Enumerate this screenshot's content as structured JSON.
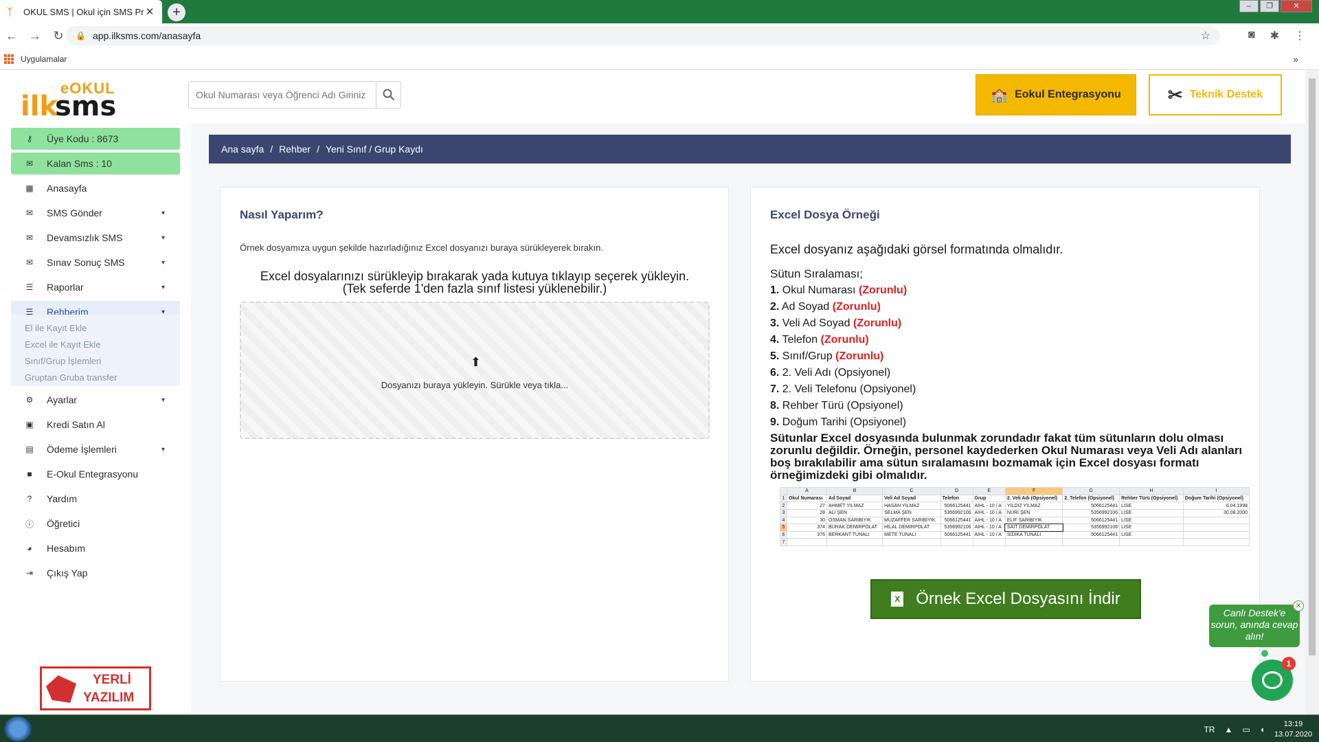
{
  "browser": {
    "tab_title": "OKUL SMS | Okul için SMS Prog",
    "url": "app.ilksms.com/anasayfa",
    "bookmarks_label": "Uygulamalar"
  },
  "header": {
    "logo_top": "eOKUL",
    "logo_ilk": "ilk",
    "logo_sms": "sms",
    "search_placeholder": "Okul Numarası veya Öğrenci Adı Giriniz",
    "eokul_button": "Eokul Entegrasyonu",
    "destek_button": "Teknik Destek"
  },
  "sidebar": {
    "uye_kodu": "Üye Kodu : 8673",
    "kalan_sms": "Kalan Sms : 10",
    "items": [
      {
        "label": "Anasayfa"
      },
      {
        "label": "SMS Gönder"
      },
      {
        "label": "Devamsızlık SMS"
      },
      {
        "label": "Sınav Sonuç SMS"
      },
      {
        "label": "Raporlar"
      },
      {
        "label": "Rehberim"
      },
      {
        "label": "Ayarlar"
      },
      {
        "label": "Kredi Satın Al"
      },
      {
        "label": "Ödeme İşlemleri"
      },
      {
        "label": "E-Okul Entegrasyonu"
      },
      {
        "label": "Yardım"
      },
      {
        "label": "Öğretici"
      },
      {
        "label": "Hesabım"
      },
      {
        "label": "Çıkış Yap"
      }
    ],
    "subitems": [
      {
        "label": "El ile Kayıt Ekle"
      },
      {
        "label": "Excel ile Kayıt Ekle"
      },
      {
        "label": "Sınıf/Grup İşlemleri"
      },
      {
        "label": "Gruptan Gruba transfer"
      }
    ],
    "badge_line1": "YERLİ",
    "badge_line2": "YAZILIM"
  },
  "breadcrumb": {
    "items": [
      "Ana sayfa",
      "Rehber",
      "Yeni Sınıf / Grup Kaydı"
    ],
    "sep": "/"
  },
  "left_card": {
    "title": "Nasıl Yaparım?",
    "hint": "Örnek dosyamıza uygun şekilde hazırladığınız Excel dosyanızı buraya sürükleyerek bırakın.",
    "drop_head_1": "Excel dosyalarınızı sürükleyip bırakarak yada kutuya tıklayıp seçerek yükleyin.",
    "drop_head_2": "(Tek seferde 1'den fazla sınıf listesi yüklenebilir.)",
    "drop_text": "Dosyanızı buraya yükleyin. Sürükle veya tıkla..."
  },
  "right_card": {
    "title": "Excel Dosya Örneği",
    "subtitle": "Excel dosyanız aşağıdaki görsel formatında olmalıdır.",
    "sutun_label": "Sütun Sıralaması;",
    "columns": [
      {
        "num": "1.",
        "name": "Okul Numarası",
        "tag": "(Zorunlu)",
        "required": true
      },
      {
        "num": "2.",
        "name": "Ad Soyad",
        "tag": "(Zorunlu)",
        "required": true
      },
      {
        "num": "3.",
        "name": "Veli Ad Soyad",
        "tag": "(Zorunlu)",
        "required": true
      },
      {
        "num": "4.",
        "name": "Telefon",
        "tag": "(Zorunlu)",
        "required": true
      },
      {
        "num": "5.",
        "name": "Sınıf/Grup",
        "tag": "(Zorunlu)",
        "required": true
      },
      {
        "num": "6.",
        "name": "2. Veli Adı (Opsiyonel)",
        "tag": "",
        "required": false
      },
      {
        "num": "7.",
        "name": "2. Veli Telefonu (Opsiyonel)",
        "tag": "",
        "required": false
      },
      {
        "num": "8.",
        "name": "Rehber Türü (Opsiyonel)",
        "tag": "",
        "required": false
      },
      {
        "num": "9.",
        "name": "Doğum Tarihi (Opsiyonel)",
        "tag": "",
        "required": false
      }
    ],
    "note": "Sütunlar Excel dosyasında bulunmak zorundadır fakat tüm sütunların dolu olması zorunlu değildir. Örneğin, personel kaydederken Okul Numarası veya Veli Adı alanları boş bırakılabilir ama sütun sıralamasını bozmamak için Excel dosyası formatı örneğimizdeki gibi olmalıdır.",
    "download_button": "Örnek Excel Dosyasını İndir",
    "sheet": {
      "col_letters": [
        "A",
        "B",
        "C",
        "D",
        "E",
        "F",
        "G",
        "H",
        "I"
      ],
      "headers": [
        "Okul Numarası",
        "Ad Soyad",
        "Veli Ad Soyad",
        "Telefon",
        "Grup",
        "2. Veli Adı (Opsiyonel)",
        "2. Telefon (Opsiyonel)",
        "Rehber Türü (Opsiyonel)",
        "Doğum Tarihi (Opsiyonel)"
      ],
      "rows": [
        [
          "27",
          "AHMET YILMAZ",
          "HASAN YILMAZ",
          "5066125441",
          "AİHL - 10 / A",
          "YILDIZ YILMAZ",
          "5066125441",
          "LİSE",
          "6.04.1998"
        ],
        [
          "28",
          "ALİ ŞEN",
          "SELMA ŞEN",
          "5356992106",
          "AİHL - 10 / A",
          "NURİ ŞEN",
          "5356992106",
          "LİSE",
          "30.08.2000"
        ],
        [
          "30",
          "OSMAN SARIBIYIK",
          "MUZAFFER SARIBIYIK",
          "5066125441",
          "AİHL - 10 / A",
          "ELİF SARIBIYIK",
          "5066125441",
          "LİSE",
          ""
        ],
        [
          "374",
          "BURAK DEMİRPOLAT",
          "HİLAL DEMİRPOLAT",
          "5356992106",
          "AİHL - 10 / A",
          "SAİT DEMİRPOLAT",
          "5356992106",
          "LİSE",
          ""
        ],
        [
          "376",
          "BERKANT TUNALI",
          "METE TUNALI",
          "5066125441",
          "AİHL - 10 / A",
          "SIDIKA TUNALI",
          "5066125441",
          "LİSE",
          ""
        ]
      ]
    }
  },
  "chat": {
    "bubble_text": "Canlı Destek'e sorun, anında cevap alın!",
    "badge_count": "1"
  },
  "taskbar": {
    "lang": "TR",
    "time": "13:19",
    "date": "13.07.2020"
  }
}
